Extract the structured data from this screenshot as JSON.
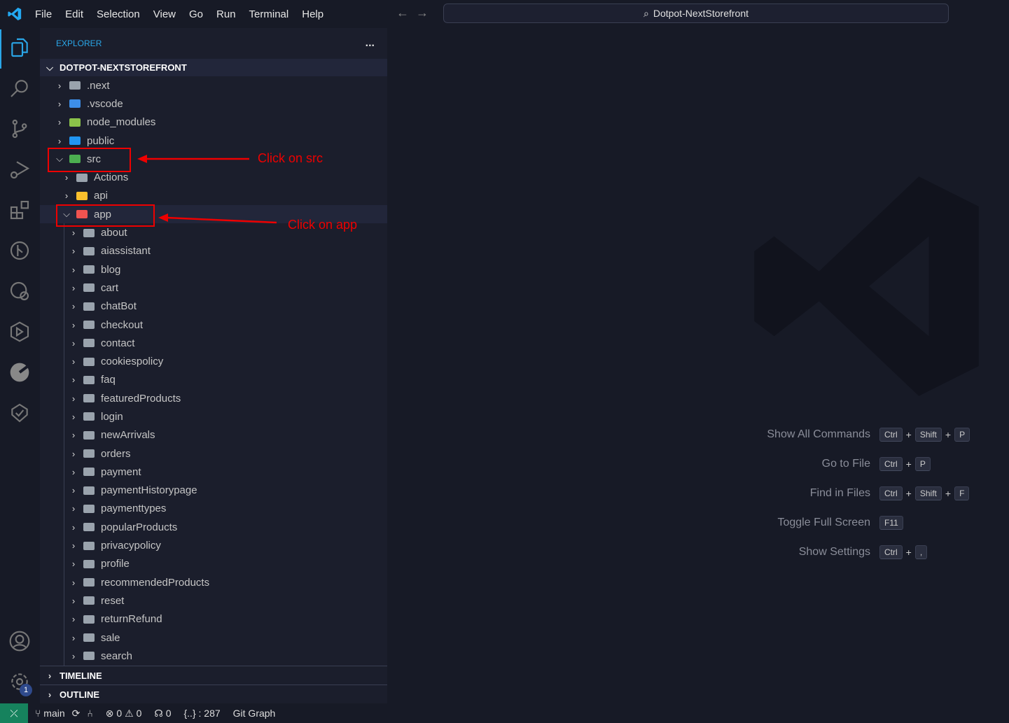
{
  "menu": [
    "File",
    "Edit",
    "Selection",
    "View",
    "Go",
    "Run",
    "Terminal",
    "Help"
  ],
  "command_center": "Dotpot-NextStorefront",
  "explorer": {
    "title": "EXPLORER",
    "more": "...",
    "root": "DOTPOT-NEXTSTOREFRONT"
  },
  "tree": [
    {
      "label": ".next",
      "depth": 0,
      "open": false,
      "color": "#9aa3ad"
    },
    {
      "label": ".vscode",
      "depth": 0,
      "open": false,
      "color": "#3d8ee8"
    },
    {
      "label": "node_modules",
      "depth": 0,
      "open": false,
      "color": "#8bc34a"
    },
    {
      "label": "public",
      "depth": 0,
      "open": false,
      "color": "#2196f3"
    },
    {
      "label": "src",
      "depth": 0,
      "open": true,
      "color": "#4caf50"
    },
    {
      "label": "Actions",
      "depth": 1,
      "open": false,
      "color": "#9aa3ad"
    },
    {
      "label": "api",
      "depth": 1,
      "open": false,
      "color": "#fbc02d"
    },
    {
      "label": "app",
      "depth": 1,
      "open": true,
      "color": "#ef5350"
    },
    {
      "label": "about",
      "depth": 2
    },
    {
      "label": "aiassistant",
      "depth": 2
    },
    {
      "label": "blog",
      "depth": 2
    },
    {
      "label": "cart",
      "depth": 2
    },
    {
      "label": "chatBot",
      "depth": 2
    },
    {
      "label": "checkout",
      "depth": 2
    },
    {
      "label": "contact",
      "depth": 2
    },
    {
      "label": "cookiespolicy",
      "depth": 2
    },
    {
      "label": "faq",
      "depth": 2
    },
    {
      "label": "featuredProducts",
      "depth": 2
    },
    {
      "label": "login",
      "depth": 2
    },
    {
      "label": "newArrivals",
      "depth": 2
    },
    {
      "label": "orders",
      "depth": 2
    },
    {
      "label": "payment",
      "depth": 2
    },
    {
      "label": "paymentHistorypage",
      "depth": 2
    },
    {
      "label": "paymenttypes",
      "depth": 2
    },
    {
      "label": "popularProducts",
      "depth": 2
    },
    {
      "label": "privacypolicy",
      "depth": 2
    },
    {
      "label": "profile",
      "depth": 2
    },
    {
      "label": "recommendedProducts",
      "depth": 2
    },
    {
      "label": "reset",
      "depth": 2
    },
    {
      "label": "returnRefund",
      "depth": 2
    },
    {
      "label": "sale",
      "depth": 2
    },
    {
      "label": "search",
      "depth": 2
    }
  ],
  "sections": {
    "timeline": "TIMELINE",
    "outline": "OUTLINE"
  },
  "annotations": {
    "src": "Click on src",
    "app": "Click on app",
    "color": "#e00000"
  },
  "shortcuts": [
    {
      "label": "Show All Commands",
      "keys": [
        "Ctrl",
        "Shift",
        "P"
      ]
    },
    {
      "label": "Go to File",
      "keys": [
        "Ctrl",
        "P"
      ]
    },
    {
      "label": "Find in Files",
      "keys": [
        "Ctrl",
        "Shift",
        "F"
      ]
    },
    {
      "label": "Toggle Full Screen",
      "keys": [
        "F11"
      ]
    },
    {
      "label": "Show Settings",
      "keys": [
        "Ctrl",
        ","
      ]
    }
  ],
  "status": {
    "branch": "main",
    "errors": "0",
    "warnings": "0",
    "ports": "0",
    "json": "{..} : 287",
    "git_graph": "Git Graph",
    "settings_badge": "1"
  }
}
